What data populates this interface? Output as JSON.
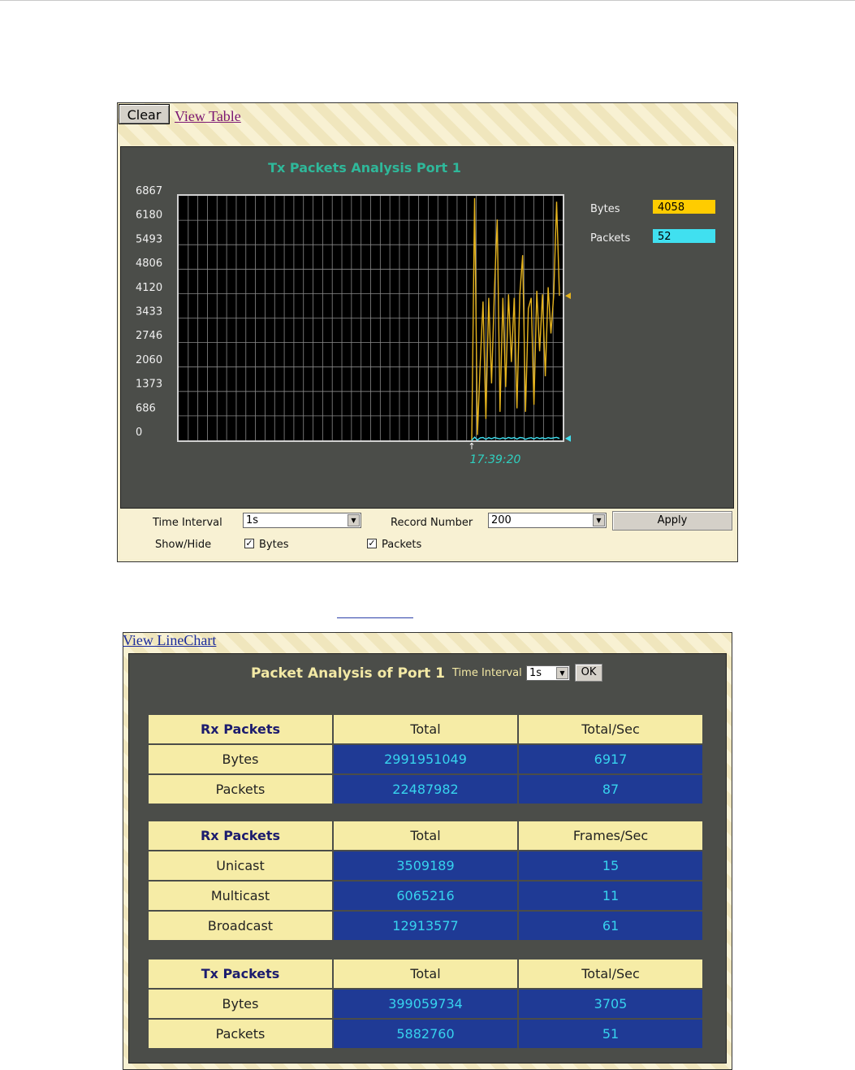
{
  "linechart_panel": {
    "clear_label": "Clear",
    "view_table_label": "View Table",
    "chart_title": "Tx Packets Analysis  Port 1",
    "legend": [
      {
        "label": "Bytes",
        "value": "4058",
        "color": "#ffcc00"
      },
      {
        "label": "Packets",
        "value": "52",
        "color": "#40e0f0"
      }
    ],
    "time_label": "17:39:20",
    "controls": {
      "time_interval_label": "Time Interval",
      "time_interval_value": "1s",
      "record_number_label": "Record Number",
      "record_number_value": "200",
      "apply_label": "Apply",
      "show_hide_label": "Show/Hide",
      "bytes_label": "Bytes",
      "packets_label": "Packets",
      "bytes_checked": true,
      "packets_checked": true
    }
  },
  "chart_data": {
    "type": "line",
    "title": "Tx Packets Analysis  Port 1",
    "yticks": [
      "6867",
      "6180",
      "5493",
      "4806",
      "4120",
      "3433",
      "2746",
      "2060",
      "1373",
      "686",
      "0"
    ],
    "ylim": [
      0,
      6867
    ],
    "grid": true,
    "series": [
      {
        "name": "Bytes",
        "color": "#e6b41e",
        "values": [
          0,
          6800,
          150,
          2200,
          3900,
          600,
          4000,
          1600,
          4200,
          6200,
          800,
          4000,
          1500,
          4100,
          2200,
          4000,
          900,
          4100,
          5200,
          800,
          3700,
          4000,
          1000,
          4200,
          2500,
          4100,
          1800,
          4300,
          3000,
          4100,
          6700,
          4058
        ]
      },
      {
        "name": "Packets",
        "color": "#40e0f0",
        "values": [
          0,
          90,
          10,
          70,
          80,
          30,
          75,
          45,
          80,
          60,
          40,
          70,
          45,
          80,
          55,
          78,
          35,
          80,
          70,
          30,
          60,
          75,
          40,
          80,
          50,
          70,
          45,
          75,
          55,
          70,
          85,
          52
        ]
      }
    ]
  },
  "table_panel": {
    "view_linechart_label": "View LineChart",
    "title": "Packet Analysis of Port 1",
    "time_interval_label": "Time Interval",
    "time_interval_value": "1s",
    "ok_label": "OK",
    "sections": [
      {
        "header": [
          "Rx Packets",
          "Total",
          "Total/Sec"
        ],
        "rows": [
          [
            "Bytes",
            "2991951049",
            "6917"
          ],
          [
            "Packets",
            "22487982",
            "87"
          ]
        ]
      },
      {
        "header": [
          "Rx Packets",
          "Total",
          "Frames/Sec"
        ],
        "rows": [
          [
            "Unicast",
            "3509189",
            "15"
          ],
          [
            "Multicast",
            "6065216",
            "11"
          ],
          [
            "Broadcast",
            "12913577",
            "61"
          ]
        ]
      },
      {
        "header": [
          "Tx Packets",
          "Total",
          "Total/Sec"
        ],
        "rows": [
          [
            "Bytes",
            "399059734",
            "3705"
          ],
          [
            "Packets",
            "5882760",
            "51"
          ]
        ]
      }
    ]
  }
}
